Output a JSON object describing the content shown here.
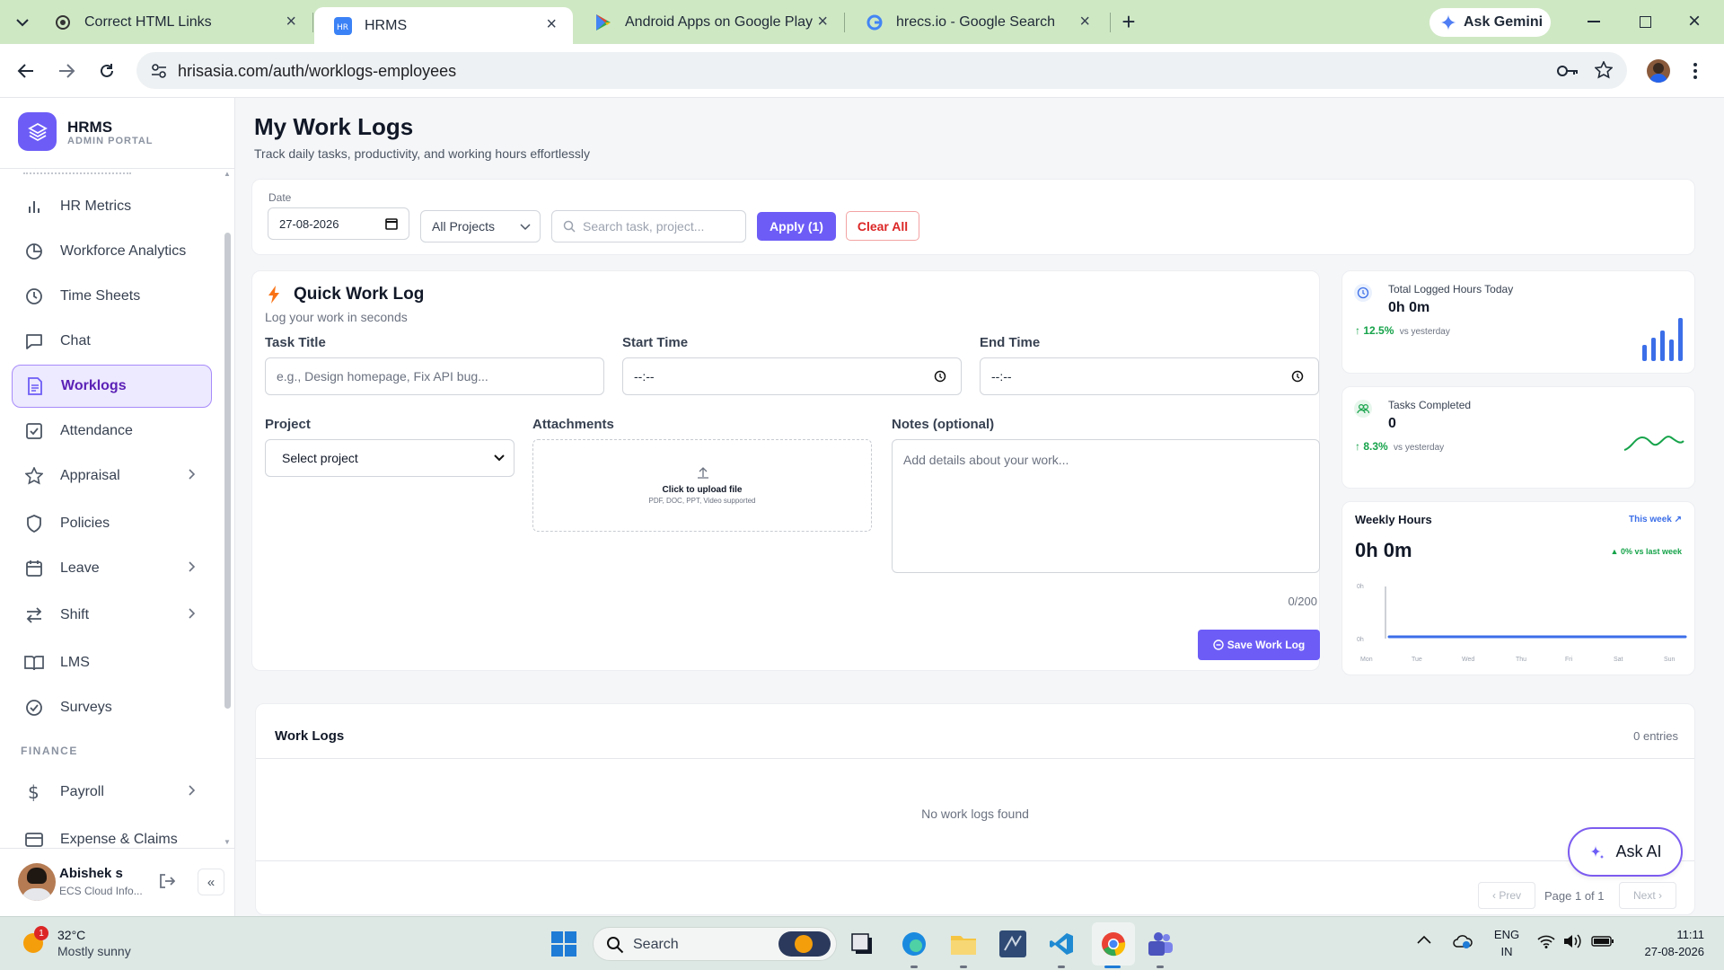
{
  "browser": {
    "tabs": [
      {
        "title": "Correct HTML Links",
        "favicon": "openai-icon"
      },
      {
        "title": "HRMS",
        "favicon": "hrms-icon",
        "active": true
      },
      {
        "title": "Android Apps on Google Play",
        "favicon": "google-play-icon"
      },
      {
        "title": "hrecs.io - Google Search",
        "favicon": "google-icon"
      }
    ],
    "ask_gemini": "Ask Gemini",
    "url": "hrisasia.com/auth/worklogs-employees"
  },
  "brand": {
    "name": "HRMS",
    "subtitle": "ADMIN PORTAL",
    "color": "#6d5df6"
  },
  "sidebar": {
    "items": [
      {
        "label": "HR Metrics",
        "icon": "bar-chart-icon"
      },
      {
        "label": "Workforce Analytics",
        "icon": "pie-chart-icon"
      },
      {
        "label": "Time Sheets",
        "icon": "clock-icon"
      },
      {
        "label": "Chat",
        "icon": "chat-icon"
      },
      {
        "label": "Worklogs",
        "icon": "document-icon",
        "active": true
      },
      {
        "label": "Attendance",
        "icon": "checkbox-icon"
      },
      {
        "label": "Appraisal",
        "icon": "star-icon",
        "has_children": true
      },
      {
        "label": "Policies",
        "icon": "shield-icon"
      },
      {
        "label": "Leave",
        "icon": "calendar-icon",
        "has_children": true
      },
      {
        "label": "Shift",
        "icon": "swap-icon",
        "has_children": true
      },
      {
        "label": "LMS",
        "icon": "book-icon"
      },
      {
        "label": "Surveys",
        "icon": "check-circle-icon"
      }
    ],
    "section_finance": "FINANCE",
    "finance_items": [
      {
        "label": "Payroll",
        "icon": "dollar-icon",
        "has_children": true
      },
      {
        "label": "Expense & Claims",
        "icon": "card-icon"
      }
    ],
    "user": {
      "name": "Abishek s",
      "org": "ECS Cloud Info..."
    }
  },
  "page": {
    "title": "My Work Logs",
    "subtitle": "Track daily tasks, productivity, and working hours effortlessly"
  },
  "filters": {
    "date_label": "Date",
    "date_value": "27-08-2026",
    "project_value": "All Projects",
    "search_placeholder": "Search task, project...",
    "apply_label": "Apply (1)",
    "clear_label": "Clear All"
  },
  "quick_log": {
    "title": "Quick Work Log",
    "subtitle": "Log your work in seconds",
    "task_label": "Task Title",
    "task_placeholder": "e.g., Design homepage, Fix API bug...",
    "start_label": "Start Time",
    "start_value": "--:--",
    "end_label": "End Time",
    "end_value": "--:--",
    "project_label": "Project",
    "project_value": "Select project",
    "attach_label": "Attachments",
    "attach_cta": "Click to upload file",
    "attach_hint": "PDF, DOC, PPT, Video supported",
    "notes_label": "Notes (optional)",
    "notes_placeholder": "Add details about your work...",
    "char_count": "0/200",
    "save_label": "Save Work Log"
  },
  "stats": {
    "logged": {
      "label": "Total Logged Hours Today",
      "value": "0h 0m",
      "change": "12.5%",
      "suffix": "vs yesterday"
    },
    "tasks": {
      "label": "Tasks Completed",
      "value": "0",
      "change": "8.3%",
      "suffix": "vs yesterday"
    },
    "weekly": {
      "title": "Weekly Hours",
      "link": "This week ↗",
      "value": "0h 0m",
      "change": "▲ 0% vs last week",
      "y_ticks": [
        "0h",
        "0h"
      ],
      "days": [
        "Mon",
        "Tue",
        "Wed",
        "Thu",
        "Fri",
        "Sat",
        "Sun"
      ]
    }
  },
  "chart_data": {
    "type": "line",
    "categories": [
      "Mon",
      "Tue",
      "Wed",
      "Thu",
      "Fri",
      "Sat",
      "Sun"
    ],
    "series": [
      {
        "values": [
          0,
          0,
          0,
          0,
          0,
          0,
          0
        ]
      }
    ],
    "ylim": [
      0,
      0
    ],
    "color": "#3b6ee8"
  },
  "worklogs": {
    "title": "Work Logs",
    "count": "0 entries",
    "empty": "No work logs found",
    "prev": "‹ Prev",
    "page": "Page 1 of 1",
    "next": "Next ›"
  },
  "ask_ai": "Ask AI",
  "taskbar": {
    "weather_temp": "32°C",
    "weather_desc": "Mostly sunny",
    "weather_badge": "1",
    "search_label": "Search",
    "lang_line1": "ENG",
    "lang_line2": "IN",
    "time": "11:11",
    "date": "27-08-2026"
  },
  "colors": {
    "accent": "#6d5df6",
    "danger": "#dc2626",
    "success": "#16a34a",
    "blue": "#3b6ee8"
  }
}
